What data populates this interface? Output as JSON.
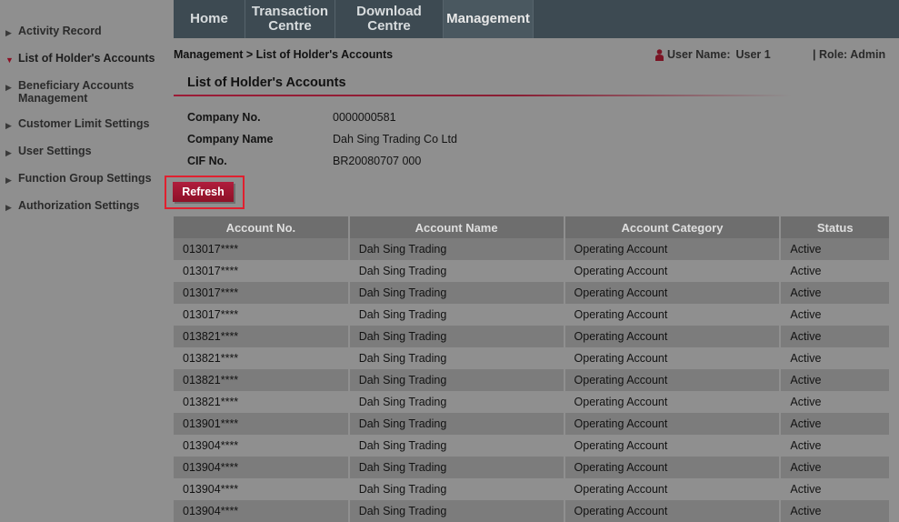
{
  "sidebar": {
    "items": [
      {
        "label": "Activity Record",
        "active": false
      },
      {
        "label": "List of Holder's Accounts",
        "active": true
      },
      {
        "label": "Beneficiary Accounts Management",
        "active": false
      },
      {
        "label": "Customer Limit Settings",
        "active": false
      },
      {
        "label": "User Settings",
        "active": false
      },
      {
        "label": "Function Group Settings",
        "active": false
      },
      {
        "label": "Authorization Settings",
        "active": false
      }
    ]
  },
  "nav": {
    "home": "Home",
    "transaction_line1": "Transaction",
    "transaction_line2": "Centre",
    "download_line1": "Download",
    "download_line2": "Centre",
    "management": "Management"
  },
  "breadcrumb": "Management > List of Holder's Accounts",
  "user": {
    "label": "User Name:",
    "value": "User 1",
    "role": "| Role: Admin"
  },
  "page_title": "List of Holder's Accounts",
  "company": {
    "no_label": "Company No.",
    "no_value": "0000000581",
    "name_label": "Company Name",
    "name_value": "Dah Sing Trading Co Ltd",
    "cif_label": "CIF No.",
    "cif_value": "BR20080707 000"
  },
  "refresh_label": "Refresh",
  "table": {
    "headers": [
      "Account No.",
      "Account Name",
      "Account Category",
      "Status"
    ],
    "rows": [
      [
        "013017****",
        "Dah Sing Trading",
        "Operating Account",
        "Active"
      ],
      [
        "013017****",
        "Dah Sing Trading",
        "Operating Account",
        "Active"
      ],
      [
        "013017****",
        "Dah Sing Trading",
        "Operating Account",
        "Active"
      ],
      [
        "013017****",
        "Dah Sing Trading",
        "Operating Account",
        "Active"
      ],
      [
        "013821****",
        "Dah Sing Trading",
        "Operating Account",
        "Active"
      ],
      [
        "013821****",
        "Dah Sing Trading",
        "Operating Account",
        "Active"
      ],
      [
        "013821****",
        "Dah Sing Trading",
        "Operating Account",
        "Active"
      ],
      [
        "013821****",
        "Dah Sing Trading",
        "Operating Account",
        "Active"
      ],
      [
        "013901****",
        "Dah Sing Trading",
        "Operating Account",
        "Active"
      ],
      [
        "013904****",
        "Dah Sing Trading",
        "Operating Account",
        "Active"
      ],
      [
        "013904****",
        "Dah Sing Trading",
        "Operating Account",
        "Active"
      ],
      [
        "013904****",
        "Dah Sing Trading",
        "Operating Account",
        "Active"
      ],
      [
        "013904****",
        "Dah Sing Trading",
        "Operating Account",
        "Active"
      ]
    ]
  },
  "colors": {
    "accent": "#9c1b36",
    "nav_bg": "#3d4a52",
    "header_bg": "#6e6e6e",
    "highlight_border": "#e0202f"
  }
}
